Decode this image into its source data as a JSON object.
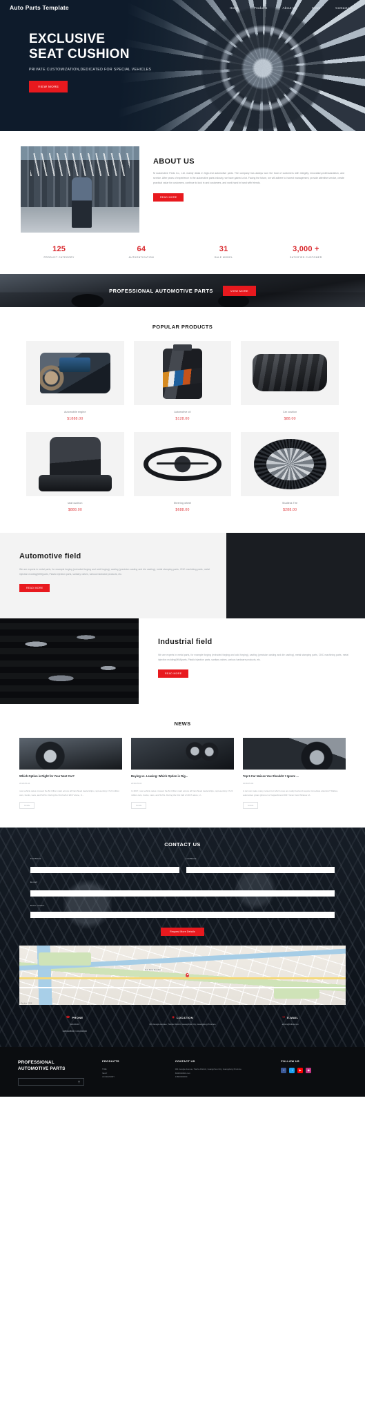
{
  "header": {
    "brand": "Auto Parts Template",
    "nav": [
      {
        "label": "Home"
      },
      {
        "label": "Products"
      },
      {
        "label": "About Us"
      },
      {
        "label": "News"
      },
      {
        "label": "Contact Us"
      }
    ]
  },
  "hero": {
    "title_line1": "EXCLUSIVE",
    "title_line2": "SEAT CUSHION",
    "subtitle": "PRIVATE CUSTOMIZATION,DEDICATED FOR SPECIAL VEHICLES",
    "cta": "VIEW MORE"
  },
  "about": {
    "title": "ABOUT US",
    "body": "M Automotive Parts Co., Ltd. mainly deals in high-end automotive parts. The company has always won the trust of customers with integrity, innovation,professionalism, and service. After years of experience in the automotive parts industry, we have gained a lot. Facing the future, we will adhere to honest management, provide attentive service, create practical value for customers, continue to lock in and customers, and work hand in hand with friends.",
    "cta": "READ MORE"
  },
  "stats": [
    {
      "number": "125",
      "label": "PRODUCT CATEGORY"
    },
    {
      "number": "64",
      "label": "AUTHENTICATION"
    },
    {
      "number": "31",
      "label": "SALE MODEL"
    },
    {
      "number": "3,000 +",
      "label": "SATISFIED CUSTOMER"
    }
  ],
  "banner": {
    "title": "PROFESSIONAL AUTOMOTIVE PARTS",
    "cta": "VIEW MORE"
  },
  "products": {
    "section_title": "POPULAR PRODUCTS",
    "row1": [
      {
        "name": "Automobile engine",
        "price": "$1888.00",
        "art": "art-engine"
      },
      {
        "name": "Automotive oil",
        "price": "$128.00",
        "art": "art-oil"
      },
      {
        "name": "Car cushion",
        "price": "$88.00",
        "art": "art-cushion"
      }
    ],
    "row2": [
      {
        "name": "seat cushion",
        "price": "$888.00",
        "art": "art-seat"
      },
      {
        "name": "Steering wheel",
        "price": "$688.00",
        "art": "art-wheel"
      },
      {
        "name": "Studless Tire",
        "price": "$288.00",
        "art": "art-tire"
      }
    ]
  },
  "fields": {
    "automotive": {
      "title": "Automotive field",
      "body": "We are experts in metal parts, for example forging (extruded forging and cold forging), casting (precision casting and die casting), metal stamping parts, CNC machining parts, metal injection molding(MIM)parts, Plastic injection parts, sanitary valves, various hardware products, etc.",
      "cta": "READ MORE"
    },
    "industrial": {
      "title": "Industrial field",
      "body": "We are experts in metal parts, for example forging (extruded forging and cold forging), casting (precision casting and die casting), metal stamping parts, CNC machining parts, metal injection molding(MIM)parts, Plastic injection parts, sanitary valves, various hardware products, etc.",
      "cta": "READ MORE"
    }
  },
  "news": {
    "section_title": "NEWS",
    "items": [
      {
        "title": "Which Option is Right for Your Next Car?",
        "date": "2018-05-04",
        "desc": "new vehicle sales crossed the $1 trillion mark across all franchised dealerships, representing 17.24 million cars, trucks, vans, and SUVs. During the first half of 2017 alone, U...",
        "more": "MORE"
      },
      {
        "title": "Buying vs. Leasing: Which Option is Rig...",
        "date": "2018-05-04",
        "desc": "In 2017, new vehicle sales crossed the $1 trillion mark across all franchised dealerships, representing 17.24 million cars, trucks, vans, and SUVs. During the first half of 2017 alone, U...",
        "more": "MORE"
      },
      {
        "title": "Top 5 Car Noises You Shouldn’ t Ignore ...",
        "date": "2018-05-04",
        "desc": "A car can make many noises but which ones are really bad and require immediate attention? Rattles, automotive groan glimmer or frappe8d and 2017 Gran Cam Window of...",
        "more": "MORE"
      }
    ]
  },
  "contact": {
    "title": "CONTACT US",
    "fields": {
      "firstname_label": "FirstName",
      "firstname_value": "",
      "lastname_label": "LastName",
      "lastname_value": "",
      "email_label": "E-mail",
      "email_value": "",
      "message_label": "Enter content",
      "message_value": ""
    },
    "submit": "Request More Details"
  },
  "map": {
    "label": "Auto Parts Template",
    "attribution": "Map data ©2018"
  },
  "contact_info": [
    {
      "icon": "phone-icon",
      "glyph": "☎",
      "title": "PHONE",
      "lines": [
        "020-00-00",
        "13800138000 / 400-000000"
      ]
    },
    {
      "icon": "location-icon",
      "glyph": "◉",
      "title": "LOCATION",
      "lines": [
        "001 Google Avenue, Tianhe District, Guangzhou City, Guangdong Province"
      ]
    },
    {
      "icon": "email-icon",
      "glyph": "✉",
      "title": "E-MAIL",
      "lines": [
        "admin@follow.com"
      ]
    }
  ],
  "footer": {
    "brand_line1": "PROFESSIONAL",
    "brand_line2": "AUTOMOTIVE PARTS",
    "search_placeholder": "",
    "search_value": "",
    "columns": [
      {
        "title": "PRODUCTS",
        "items": [
          "TIRE",
          "SEAT",
          "ACCESSORY"
        ]
      },
      {
        "title": "CONTACT US",
        "items": [
          "001 Google Avenue, Tianhe District, Guangzhou City, Guangdong Province",
          "8008000800.com",
          "13800000000"
        ]
      }
    ],
    "follow": {
      "title": "FOLLOW US",
      "socials": [
        {
          "name": "facebook-icon",
          "glyph": "f",
          "cls": "s-fb"
        },
        {
          "name": "twitter-icon",
          "glyph": "t",
          "cls": "s-tw"
        },
        {
          "name": "youtube-icon",
          "glyph": "▶",
          "cls": "s-yt"
        },
        {
          "name": "instagram-icon",
          "glyph": "◉",
          "cls": "s-in"
        }
      ]
    }
  }
}
